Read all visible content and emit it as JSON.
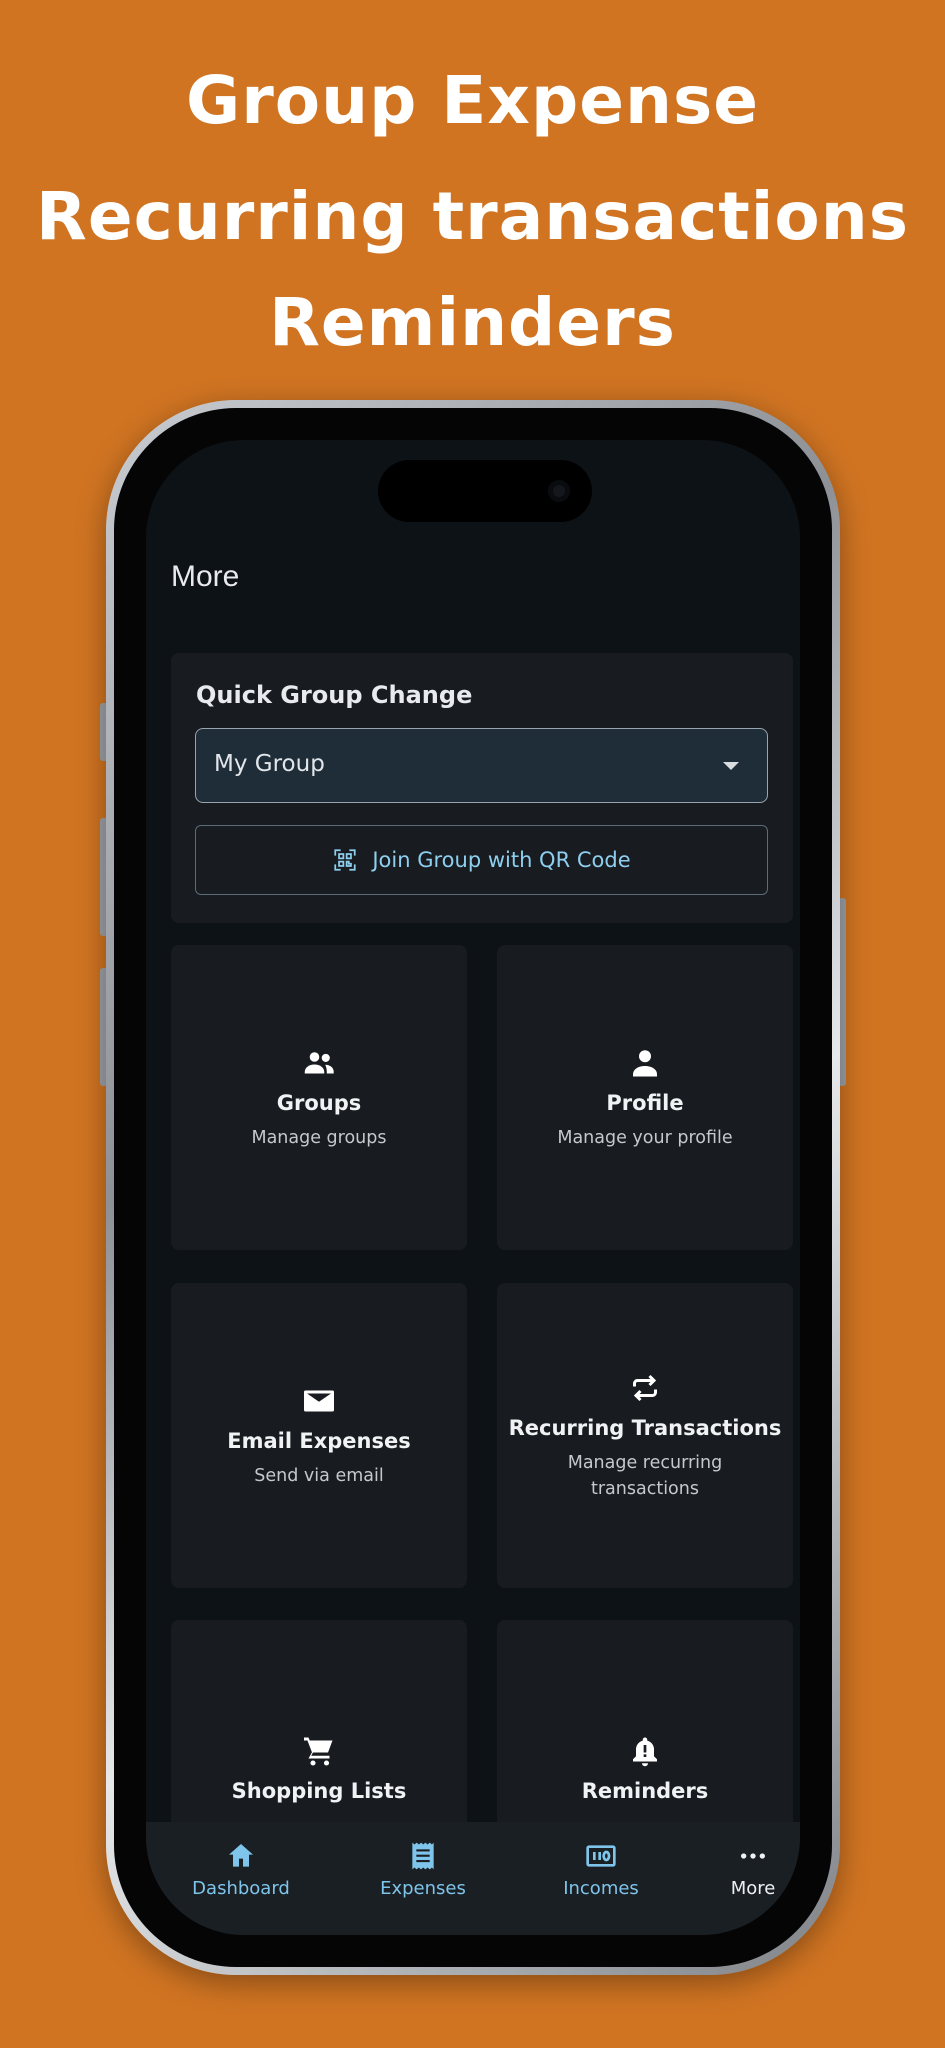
{
  "promo": {
    "line1": "Group Expense",
    "line2": "Recurring transactions",
    "line3": "Reminders"
  },
  "page": {
    "title": "More"
  },
  "quick_group": {
    "title": "Quick Group Change",
    "selected_group": "My Group",
    "join_qr_label": "Join Group with QR Code"
  },
  "tiles": [
    {
      "icon": "groups-icon",
      "title": "Groups",
      "subtitle": "Manage groups"
    },
    {
      "icon": "person-icon",
      "title": "Profile",
      "subtitle": "Manage your profile"
    },
    {
      "icon": "email-icon",
      "title": "Email Expenses",
      "subtitle": "Send via email"
    },
    {
      "icon": "repeat-icon",
      "title": "Recurring Transactions",
      "subtitle": "Manage recurring transactions"
    },
    {
      "icon": "cart-icon",
      "title": "Shopping Lists",
      "subtitle": ""
    },
    {
      "icon": "bell-alert-icon",
      "title": "Reminders",
      "subtitle": ""
    }
  ],
  "nav": [
    {
      "icon": "home-icon",
      "label": "Dashboard",
      "active": false
    },
    {
      "icon": "receipt-icon",
      "label": "Expenses",
      "active": false
    },
    {
      "icon": "cash-icon",
      "label": "Incomes",
      "active": false
    },
    {
      "icon": "more-dots-icon",
      "label": "More",
      "active": true
    }
  ],
  "colors": {
    "background": "#d07422",
    "screen": "#0d1217",
    "card": "#181c20",
    "accent": "#7fc4ea"
  }
}
